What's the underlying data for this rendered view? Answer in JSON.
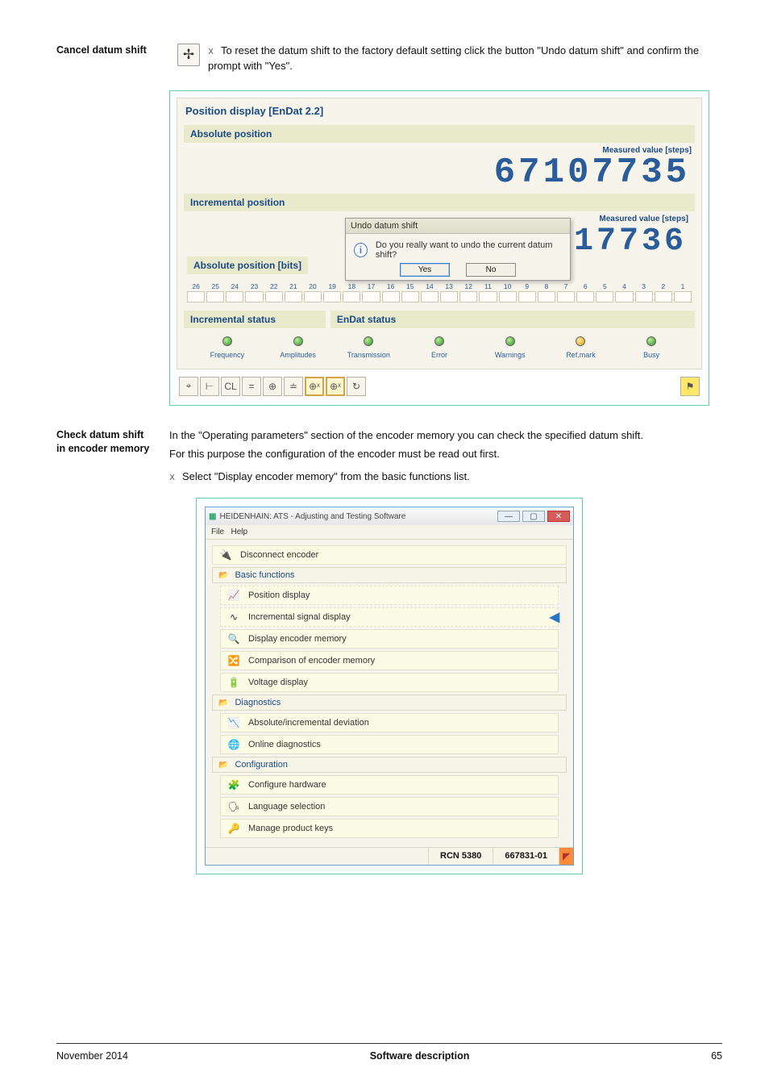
{
  "block1": {
    "heading": "Cancel datum shift",
    "text": "To reset the datum shift to the factory default setting click the button \"Undo datum shift\" and confirm the prompt with \"Yes\"."
  },
  "fig1": {
    "title": "Position display [EnDat 2.2]",
    "abs_pos_label": "Absolute position",
    "mv_label": "Measured value [steps]",
    "abs_value": "67107735",
    "inc_pos_label": "Incremental position",
    "inc_value": "17736",
    "abs_bits_label": "Absolute position [bits]",
    "dialog": {
      "title": "Undo datum shift",
      "text": "Do you really want to undo the current datum shift?",
      "yes": "Yes",
      "no": "No"
    },
    "bits": [
      "26",
      "25",
      "24",
      "23",
      "22",
      "21",
      "20",
      "19",
      "18",
      "17",
      "16",
      "15",
      "14",
      "13",
      "12",
      "11",
      "10",
      "9",
      "8",
      "7",
      "6",
      "5",
      "4",
      "3",
      "2",
      "1"
    ],
    "incr_status_label": "Incremental status",
    "endat_status_label": "EnDat status",
    "statuses": {
      "frequency": "Frequency",
      "amplitudes": "Amplitudes",
      "transmission": "Transmission",
      "error": "Error",
      "warnings": "Warnings",
      "refmark": "Ref.mark",
      "busy": "Busy"
    },
    "toolbar": [
      "⌖",
      "⊢",
      "CL",
      "=",
      "⊕",
      "≐",
      "⊕ˣ",
      "⊕ˣ",
      "↻"
    ]
  },
  "block2": {
    "heading_l1": "Check datum shift",
    "heading_l2": "in encoder memory",
    "p1": "In the \"Operating parameters\" section of the encoder memory you can check the specified datum shift.",
    "p2": "For this purpose the configuration of the encoder must be read out first.",
    "p3": "Select \"Display encoder memory\" from the basic functions list."
  },
  "fig2": {
    "title": "HEIDENHAIN: ATS - Adjusting and Testing Software",
    "menu": {
      "file": "File",
      "help": "Help"
    },
    "disconnect": "Disconnect encoder",
    "basic_functions": "Basic functions",
    "items_basic": {
      "position_display": "Position display",
      "incremental": "Incremental signal display",
      "display_mem": "Display encoder memory",
      "compare_mem": "Comparison of encoder memory",
      "voltage": "Voltage display"
    },
    "diagnostics": "Diagnostics",
    "items_diag": {
      "absinc": "Absolute/incremental deviation",
      "online": "Online diagnostics"
    },
    "configuration": "Configuration",
    "items_conf": {
      "cfg_hw": "Configure hardware",
      "lang": "Language selection",
      "keys": "Manage product keys"
    },
    "status": {
      "rcn": "RCN 5380",
      "id": "667831-01"
    }
  },
  "footer": {
    "left": "November 2014",
    "mid": "Software description",
    "right": "65"
  }
}
